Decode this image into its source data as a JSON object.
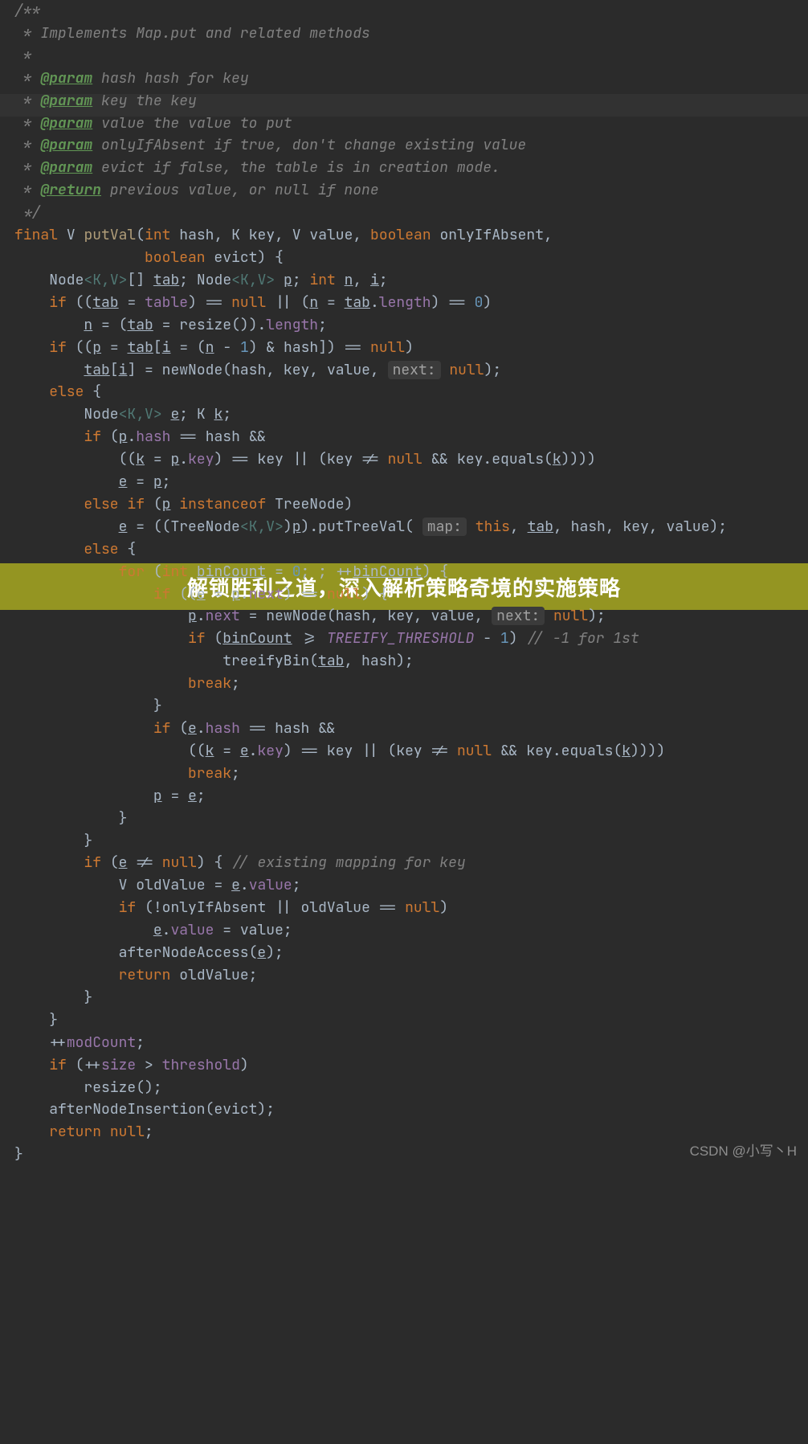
{
  "javadoc": {
    "open": "/**",
    "l1": " * Implements Map.put and related methods",
    "l2": " *",
    "p1": {
      "tag": "@param",
      "rest": " hash hash for key"
    },
    "p2": {
      "tag": "@param",
      "rest": " key the key"
    },
    "p3": {
      "tag": "@param",
      "rest": " value the value to put"
    },
    "p4": {
      "tag": "@param",
      "rest": " onlyIfAbsent if true, don't change existing value"
    },
    "p5": {
      "tag": "@param",
      "rest": " evict if false, the table is in creation mode."
    },
    "ret": {
      "tag": "@return",
      "rest": " previous value, or null if none"
    },
    "close": " */"
  },
  "kw": {
    "final": "final",
    "int": "int",
    "boolean": "boolean",
    "if": "if",
    "else": "else",
    "null": "null",
    "instanceof": "instanceof",
    "break": "break",
    "return": "return",
    "for": "for",
    "this": "this"
  },
  "id": {
    "V": "V",
    "K": "K",
    "putVal": "putVal",
    "hash": "hash",
    "key": "key",
    "value": "value",
    "onlyIfAbsent": "onlyIfAbsent",
    "evict": "evict",
    "Node": "Node",
    "tab": "tab",
    "p": "p",
    "n": "n",
    "i": "i",
    "table": "table",
    "resize": "resize",
    "length": "length",
    "newNode": "newNode",
    "e": "e",
    "k": "k",
    "equals": "equals",
    "TreeNode": "TreeNode",
    "putTreeVal": "putTreeVal",
    "binCount": "binCount",
    "next": "next",
    "TREEIFY_THRESHOLD": "TREEIFY_THRESHOLD",
    "treeifyBin": "treeifyBin",
    "oldValue": "oldValue",
    "afterNodeAccess": "afterNodeAccess",
    "modCount": "modCount",
    "size": "size",
    "threshold": "threshold",
    "afterNodeInsertion": "afterNodeInsertion"
  },
  "hint": {
    "next": "next:",
    "map": "map:"
  },
  "cmt": {
    "forLoop": "// -1 for 1st",
    "existing": "// existing mapping for key"
  },
  "num": {
    "zero": "0",
    "one": "1"
  },
  "banner": "解锁胜利之道，深入解析策略奇境的实施策略",
  "watermark": "CSDN @小写丶H"
}
